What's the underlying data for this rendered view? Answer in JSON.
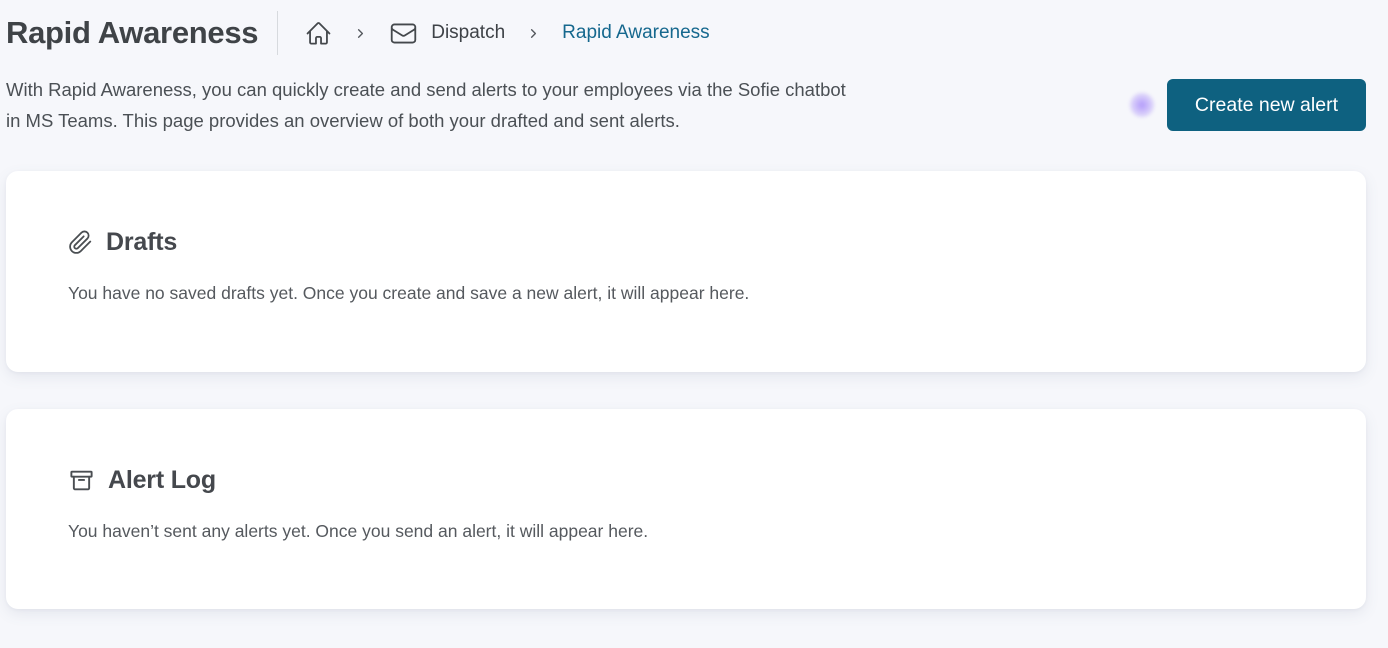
{
  "colors": {
    "page_background": "#f6f7fb",
    "card_background": "#ffffff",
    "primary_button_background": "#0e6180",
    "primary_button_text": "#ffffff",
    "breadcrumb_active_link": "#16688e",
    "heading_text": "#3f4347",
    "body_text": "#4b5055",
    "cursor_highlight": "#a78bfa"
  },
  "header": {
    "page_title": "Rapid Awareness",
    "breadcrumb": {
      "separator": "›",
      "items": [
        {
          "icon": "home-icon",
          "label": ""
        },
        {
          "icon": "mail-icon",
          "label": "Dispatch"
        },
        {
          "icon": "none",
          "label": "Rapid Awareness",
          "active": true
        }
      ]
    }
  },
  "intro": {
    "description": "With Rapid Awareness, you can quickly create and send alerts to your employees via the Sofie chatbot in MS Teams. This page provides an overview of both your drafted and sent alerts.",
    "create_button_label": "Create new alert"
  },
  "cards": [
    {
      "id": "drafts",
      "icon": "paperclip-icon",
      "title": "Drafts",
      "empty_state_text": "You have no saved drafts yet. Once you create and save a new alert, it will appear here."
    },
    {
      "id": "alert-log",
      "icon": "archive-box-icon",
      "title": "Alert Log",
      "empty_state_text": "You haven’t sent any alerts yet. Once you send an alert, it will appear here."
    }
  ]
}
